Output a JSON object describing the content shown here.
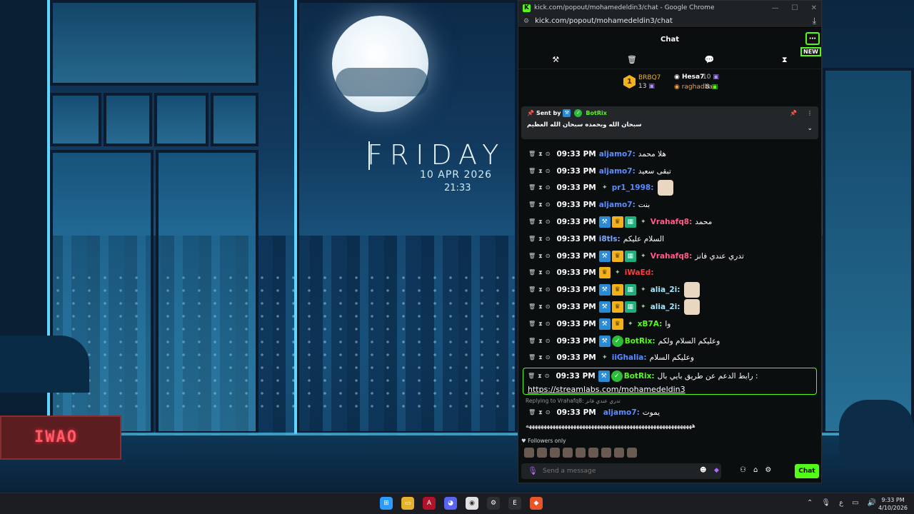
{
  "wallpaper": {
    "day": "FRIDAY",
    "date": "10 APR 2026",
    "time": "21:33",
    "sign": "IWAO"
  },
  "browser": {
    "title": "kick.com/popout/mohamedeldin3/chat - Google Chrome",
    "url": "kick.com/popout/mohamedeldin3/chat"
  },
  "chat": {
    "header": "Chat",
    "new_badge": "NEW",
    "leaderboard": {
      "rank": "1",
      "first": {
        "name": "BRBQ7",
        "count": "13"
      },
      "second": {
        "name": "Hesa7",
        "count": "10"
      },
      "third": {
        "name": "raghadba",
        "count": "8"
      }
    },
    "pinned": {
      "sent_by": "Sent by",
      "author": "BotRix",
      "text": "سبحان الله وبحمده سبحان الله العظيم"
    },
    "messages": [
      {
        "time": "09:33 PM",
        "user": "aljamo7",
        "color": "#5b8cff",
        "text": "هلا محمد"
      },
      {
        "time": "09:33 PM",
        "user": "aljamo7",
        "color": "#5b8cff",
        "text": "تبقى سعيد"
      },
      {
        "time": "09:33 PM",
        "user": "pr1_1998",
        "color": "#5b8cff",
        "text": ""
      },
      {
        "time": "09:33 PM",
        "user": "aljamo7",
        "color": "#5b8cff",
        "text": "بنت"
      },
      {
        "time": "09:33 PM",
        "user": "Vrahafq8",
        "color": "#ff5c8a",
        "text": "محمد"
      },
      {
        "time": "09:33 PM",
        "user": "i8tls",
        "color": "#7fa8ff",
        "text": "السلام عليكم"
      },
      {
        "time": "09:33 PM",
        "user": "Vrahafq8",
        "color": "#ff5c8a",
        "text": "تدري عندي فانز"
      },
      {
        "time": "09:33 PM",
        "user": "iWaEd",
        "color": "#ff3b3b",
        "text": ""
      },
      {
        "time": "09:33 PM",
        "user": "alia_2i",
        "color": "#9fe8ff",
        "text": ""
      },
      {
        "time": "09:33 PM",
        "user": "alia_2i",
        "color": "#9fe8ff",
        "text": ""
      },
      {
        "time": "09:33 PM",
        "user": "xB7A",
        "color": "#53fc18",
        "text": "وا"
      },
      {
        "time": "09:33 PM",
        "user": "BotRix",
        "color": "#53fc18",
        "text": "وعليكم السلام ولكم"
      },
      {
        "time": "09:33 PM",
        "user": "iiGhalia",
        "color": "#5b8cff",
        "text": "وعليكم السلام"
      }
    ],
    "highlight": {
      "time": "09:33 PM",
      "user": "BotRix",
      "text": "رابط الدعم عن طريق بايي بال :",
      "link": "https://streamlabs.com/mohamedeldin3"
    },
    "reply": {
      "hint": "Replying to Vrahafq8: تدري عندي فانز",
      "time": "09:33 PM",
      "user": "aljamo7",
      "text": "يموت",
      "long": "ههههههههههههههههههههههههههههههههههههههههههههههههههههههههه"
    },
    "followers_only": "Followers only",
    "input_placeholder": "Send a message",
    "send_label": "Chat"
  },
  "taskbar": {
    "time": "9:33 PM",
    "date": "4/10/2026",
    "lang": "ع"
  }
}
